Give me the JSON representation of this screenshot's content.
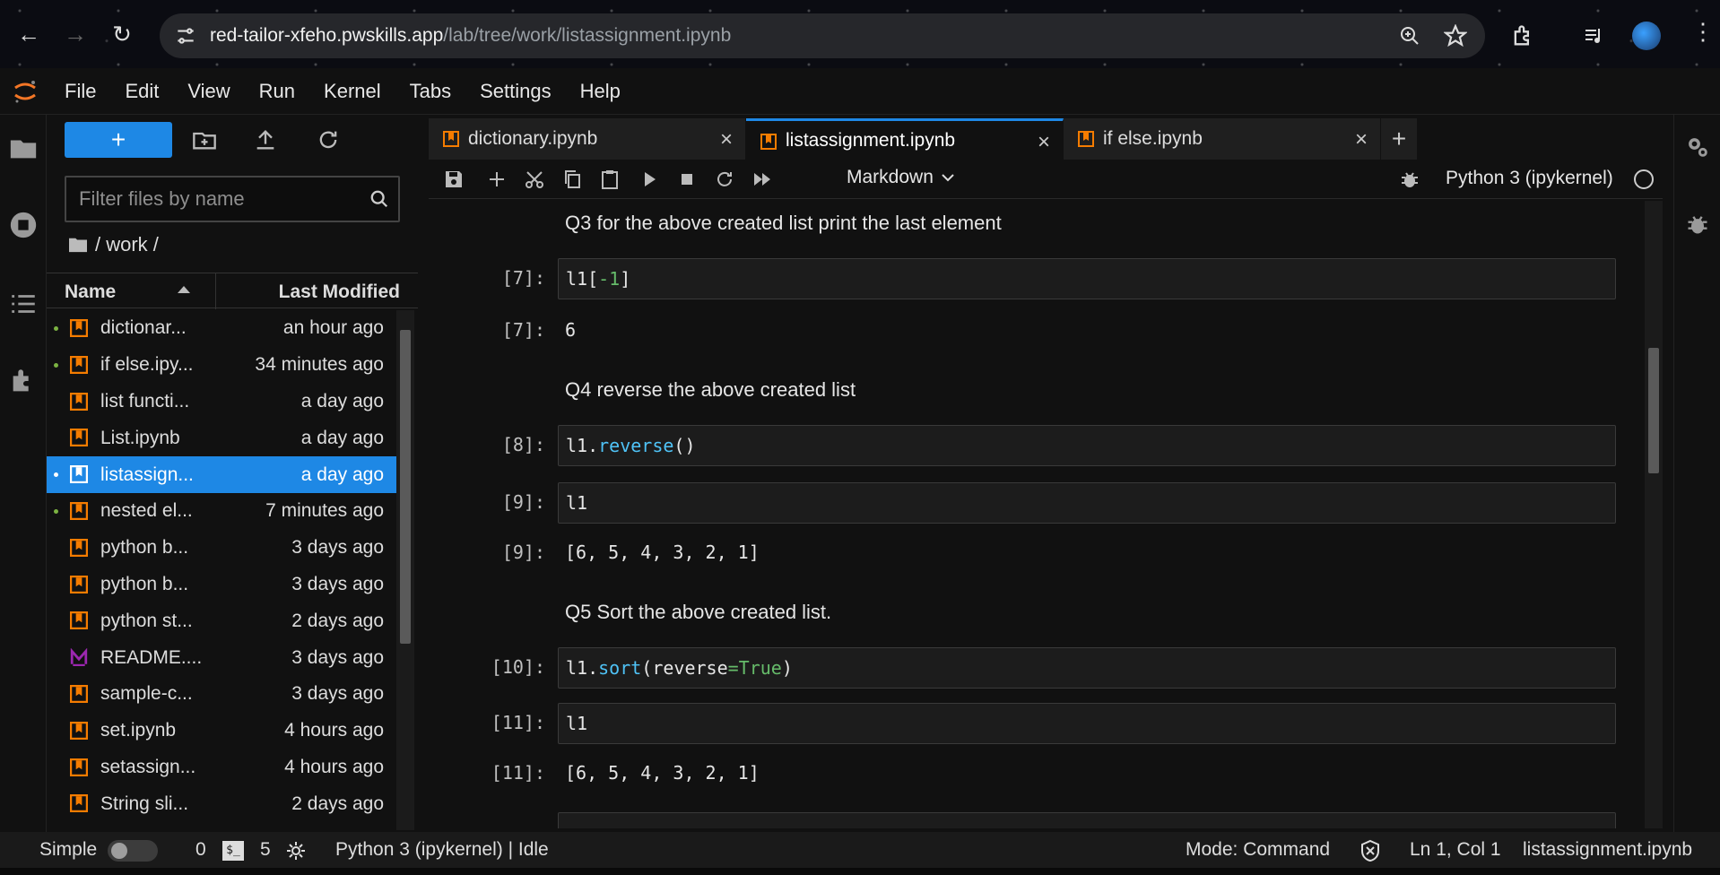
{
  "browser": {
    "url_host": "red-tailor-xfeho.pwskills.app",
    "url_path": "/lab/tree/work/listassignment.ipynb"
  },
  "menu": [
    "File",
    "Edit",
    "View",
    "Run",
    "Kernel",
    "Tabs",
    "Settings",
    "Help"
  ],
  "filebrowser": {
    "new_label": "+",
    "filter_placeholder": "Filter files by name",
    "breadcrumb": "/ work /",
    "col_name": "Name",
    "col_modified": "Last Modified",
    "files": [
      {
        "name": "dictionar...",
        "modified": "an hour ago",
        "running": true,
        "kind": "notebook"
      },
      {
        "name": "if else.ipy...",
        "modified": "34 minutes ago",
        "running": true,
        "kind": "notebook"
      },
      {
        "name": "list functi...",
        "modified": "a day ago",
        "running": false,
        "kind": "notebook"
      },
      {
        "name": "List.ipynb",
        "modified": "a day ago",
        "running": false,
        "kind": "notebook"
      },
      {
        "name": "listassign...",
        "modified": "a day ago",
        "running": true,
        "kind": "notebook",
        "selected": true
      },
      {
        "name": "nested el...",
        "modified": "7 minutes ago",
        "running": true,
        "kind": "notebook"
      },
      {
        "name": "python b...",
        "modified": "3 days ago",
        "running": false,
        "kind": "notebook"
      },
      {
        "name": "python b...",
        "modified": "3 days ago",
        "running": false,
        "kind": "notebook"
      },
      {
        "name": "python st...",
        "modified": "2 days ago",
        "running": false,
        "kind": "notebook"
      },
      {
        "name": "README....",
        "modified": "3 days ago",
        "running": false,
        "kind": "markdown"
      },
      {
        "name": "sample-c...",
        "modified": "3 days ago",
        "running": false,
        "kind": "notebook"
      },
      {
        "name": "set.ipynb",
        "modified": "4 hours ago",
        "running": false,
        "kind": "notebook"
      },
      {
        "name": "setassign...",
        "modified": "4 hours ago",
        "running": false,
        "kind": "notebook"
      },
      {
        "name": "String sli...",
        "modified": "2 days ago",
        "running": false,
        "kind": "notebook"
      }
    ]
  },
  "tabs": [
    {
      "label": "dictionary.ipynb",
      "active": false
    },
    {
      "label": "listassignment.ipynb",
      "active": true
    },
    {
      "label": "if else.ipynb",
      "active": false
    }
  ],
  "toolbar": {
    "cell_type": "Markdown",
    "kernel": "Python 3 (ipykernel)"
  },
  "cells": {
    "q3": "Q3 for the above created list print the last element",
    "p7in": "[7]:",
    "p7out": "[7]:",
    "out7": "6",
    "q4": "Q4 reverse the above created list",
    "p8": "[8]:",
    "p9in": "[9]:",
    "code9": "l1",
    "p9out": "[9]:",
    "out9": "[6, 5, 4, 3, 2, 1]",
    "q5": "Q5 Sort the above created list.",
    "p10": "[10]:",
    "p11in": "[11]:",
    "code11": "l1",
    "p11out": "[11]:",
    "out11": "[6, 5, 4, 3, 2, 1]"
  },
  "statusbar": {
    "simple": "Simple",
    "count_a": "0",
    "count_b": "5",
    "kernel_status": "Python 3 (ipykernel) | Idle",
    "mode": "Mode: Command",
    "position": "Ln 1, Col 1",
    "filename": "listassignment.ipynb"
  },
  "colors": {
    "accent": "#1e88e5",
    "notebook_icon": "#f57c00",
    "running_dot": "#7cb342"
  }
}
